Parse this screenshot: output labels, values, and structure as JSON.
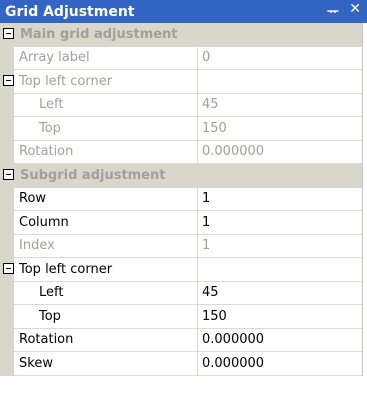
{
  "window": {
    "title": "Grid Adjustment",
    "pin_glyph": "ᅲ",
    "close_glyph": "✕"
  },
  "main": {
    "category": "Main grid adjustment",
    "array_label": {
      "name": "Array label",
      "value": "0"
    },
    "top_left_group": {
      "name": "Top left corner"
    },
    "left": {
      "name": "Left",
      "value": "45"
    },
    "top": {
      "name": "Top",
      "value": "150"
    },
    "rotation": {
      "name": "Rotation",
      "value": "0.000000"
    }
  },
  "sub": {
    "category": "Subgrid adjustment",
    "row": {
      "name": "Row",
      "value": "1"
    },
    "column": {
      "name": "Column",
      "value": "1"
    },
    "index": {
      "name": "Index",
      "value": "1"
    },
    "top_left_group": {
      "name": "Top left corner"
    },
    "left": {
      "name": "Left",
      "value": "45"
    },
    "top": {
      "name": "Top",
      "value": "150"
    },
    "rotation": {
      "name": "Rotation",
      "value": "0.000000"
    },
    "skew": {
      "name": "Skew",
      "value": "0.000000"
    }
  },
  "colors": {
    "titlebar": "#3366c4",
    "gutter": "#d9d6cc",
    "disabled_text": "#a3a099"
  }
}
